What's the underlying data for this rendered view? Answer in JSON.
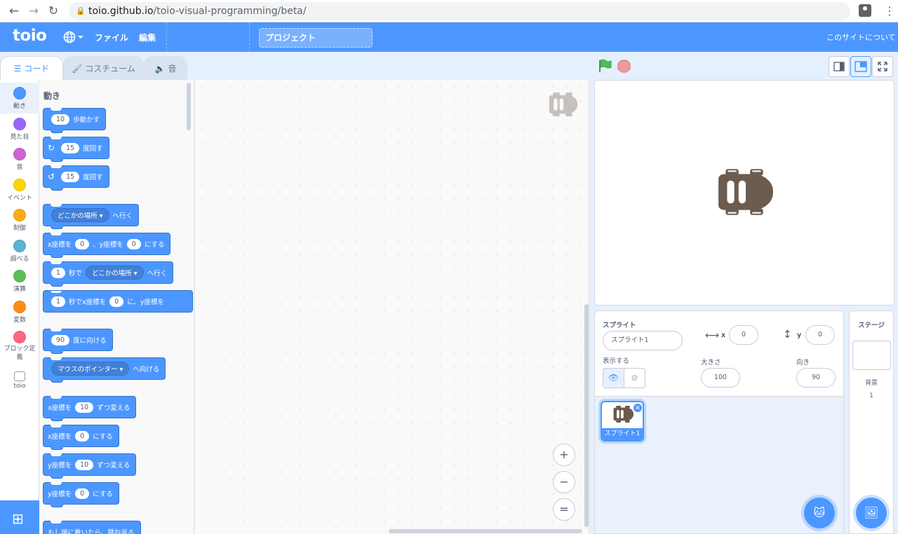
{
  "browser": {
    "back_icon": "arrow-left-icon",
    "forward_icon": "arrow-right-icon",
    "reload_icon": "reload-icon",
    "url_host": "toio.github.io",
    "url_path": "/toio-visual-programming/beta/"
  },
  "menu": {
    "logo": "toio",
    "file": "ファイル",
    "edit": "編集",
    "project_title": "プロジェクト",
    "about": "このサイトについて",
    "accent": "#4c97ff"
  },
  "tabs": [
    {
      "label": "コード",
      "icon": "code-icon"
    },
    {
      "label": "コスチューム",
      "icon": "brush-icon"
    },
    {
      "label": "音",
      "icon": "speaker-icon"
    }
  ],
  "categories": [
    {
      "label": "動き",
      "color": "#4c97ff"
    },
    {
      "label": "見た目",
      "color": "#9966ff"
    },
    {
      "label": "音",
      "color": "#cf63cf"
    },
    {
      "label": "イベント",
      "color": "#ffd500"
    },
    {
      "label": "制御",
      "color": "#ffab19"
    },
    {
      "label": "調べる",
      "color": "#5cb1d6"
    },
    {
      "label": "演算",
      "color": "#59c059"
    },
    {
      "label": "変数",
      "color": "#ff8c1a"
    },
    {
      "label": "ブロック定義",
      "color": "#ff6680"
    },
    {
      "label": "toio",
      "color": "#ffffff"
    }
  ],
  "palette": {
    "heading": "動き",
    "blocks": {
      "move": {
        "value": "10",
        "text": "歩動かす"
      },
      "turn_right": {
        "value": "15",
        "text": "度回す"
      },
      "turn_left": {
        "value": "15",
        "text": "度回す"
      },
      "goto": {
        "dropdown": "どこかの場所",
        "text": "へ行く"
      },
      "goto_xy": {
        "t1": "x座標を",
        "x": "0",
        "t2": "、y座標を",
        "y": "0",
        "t3": "にする"
      },
      "glide": {
        "sec": "1",
        "t1": "秒で",
        "dropdown": "どこかの場所",
        "t2": "へ行く"
      },
      "glide_xy": {
        "sec": "1",
        "t1": "秒でx座標を",
        "x": "0",
        "t2": "に、y座標を"
      },
      "point_dir": {
        "value": "90",
        "text": "度に向ける"
      },
      "point_towards": {
        "dropdown": "マウスのポインター",
        "text": "へ向ける"
      },
      "change_x": {
        "t1": "x座標を",
        "value": "10",
        "t2": "ずつ変える"
      },
      "set_x": {
        "t1": "x座標を",
        "value": "0",
        "t2": "にする"
      },
      "change_y": {
        "t1": "y座標を",
        "value": "10",
        "t2": "ずつ変える"
      },
      "set_y": {
        "t1": "y座標を",
        "value": "0",
        "t2": "にする"
      },
      "bounce": {
        "text": "もし端に着いたら、跳ね返る"
      }
    }
  },
  "workspace": {
    "zoom_in": "+",
    "zoom_out": "−",
    "zoom_reset": "="
  },
  "stage_controls": {
    "flag_icon": "green-flag-icon",
    "stop_icon": "stop-icon"
  },
  "sprite_info": {
    "sprite_label": "スプライト",
    "sprite_name": "スプライト1",
    "x_label": "x",
    "x_value": "0",
    "y_label": "y",
    "y_value": "0",
    "show_label": "表示する",
    "size_label": "大きさ",
    "size_value": "100",
    "direction_label": "向き",
    "direction_value": "90",
    "tile_name": "スプライト1"
  },
  "stage_panel": {
    "title": "ステージ",
    "backdrop_label": "背景",
    "backdrop_count": "1"
  }
}
